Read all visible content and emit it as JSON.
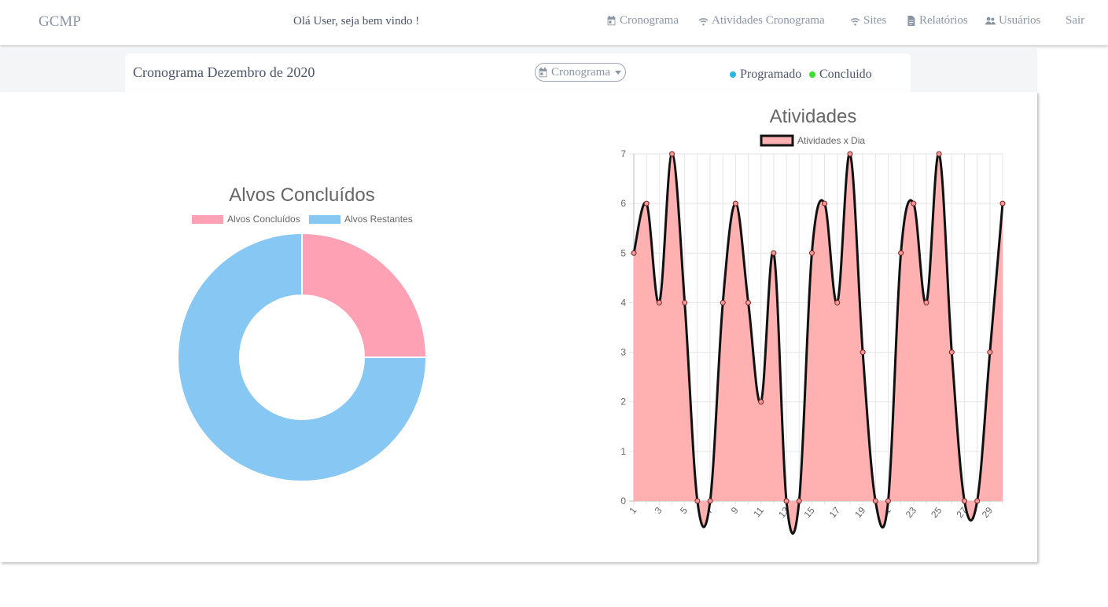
{
  "navbar": {
    "brand": "GCMP",
    "welcome": "Olá User, seja bem vindo !",
    "items": [
      {
        "label": "Cronograma",
        "icon": "calendar-icon"
      },
      {
        "label": "Atividades Cronograma",
        "icon": "wifi-icon"
      },
      {
        "label": "Sites",
        "icon": "wifi-icon"
      },
      {
        "label": "Relatórios",
        "icon": "document-icon"
      },
      {
        "label": "Usuários",
        "icon": "users-icon"
      },
      {
        "label": "Sair",
        "icon": ""
      }
    ]
  },
  "header": {
    "title": "Cronograma Dezembro de 2020",
    "dropdown_label": "Cronograma",
    "legend": [
      {
        "label": "Programado",
        "color": "#2bb5e8"
      },
      {
        "label": "Concluido",
        "color": "#3ddc2e"
      }
    ]
  },
  "colors": {
    "pink": "#ffa1b5",
    "blue": "#86c7f3",
    "area_fill": "#ffb1b1",
    "line": "#111111"
  },
  "chart_data": [
    {
      "type": "doughnut",
      "title": "Alvos Concluídos",
      "labels": [
        "Alvos Concluídos",
        "Alvos Restantes"
      ],
      "values": [
        1,
        3
      ]
    },
    {
      "type": "area",
      "title": "Atividades",
      "series": [
        {
          "name": "Atividades x Dia",
          "values": [
            5,
            6,
            4,
            7,
            4,
            0,
            0,
            4,
            6,
            4,
            2,
            5,
            0,
            0,
            5,
            6,
            4,
            7,
            3,
            0,
            0,
            5,
            6,
            4,
            7,
            3,
            0,
            0,
            3,
            6
          ]
        }
      ],
      "x": [
        1,
        2,
        3,
        4,
        5,
        6,
        7,
        8,
        9,
        10,
        11,
        12,
        13,
        14,
        15,
        16,
        17,
        18,
        19,
        20,
        21,
        22,
        23,
        24,
        25,
        26,
        27,
        28,
        29,
        30
      ],
      "x_tick_labels": [
        "1",
        "3",
        "5",
        "7",
        "9",
        "11",
        "13",
        "15",
        "17",
        "19",
        "21",
        "23",
        "25",
        "27",
        "29"
      ],
      "y_tick_labels": [
        "0",
        "1",
        "2",
        "3",
        "4",
        "5",
        "6",
        "7"
      ],
      "ylim": [
        0,
        7
      ],
      "grid": true,
      "legend": "top"
    }
  ]
}
